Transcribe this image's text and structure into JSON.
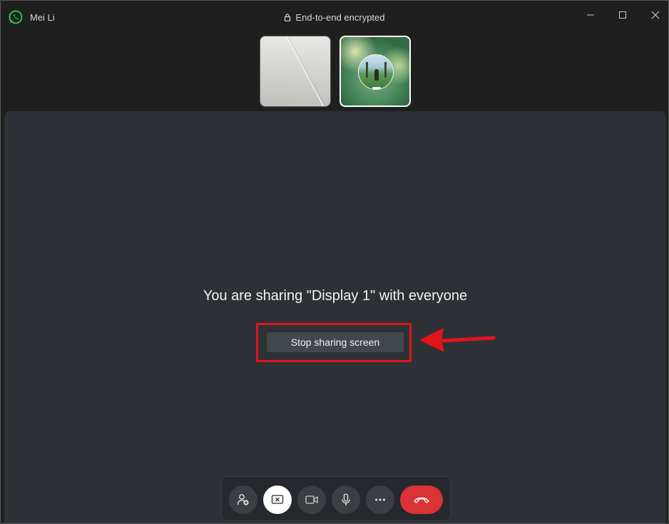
{
  "window": {
    "contact_name": "Mei Li",
    "encryption_label": "End-to-end encrypted"
  },
  "main": {
    "share_message": "You are sharing \"Display 1\" with everyone",
    "stop_button_label": "Stop sharing screen"
  },
  "controls": [
    {
      "name": "add-participant",
      "icon": "person-add-icon"
    },
    {
      "name": "screen-share",
      "icon": "stop-share-icon",
      "active": true
    },
    {
      "name": "video",
      "icon": "video-camera-icon"
    },
    {
      "name": "microphone",
      "icon": "microphone-icon"
    },
    {
      "name": "more-options",
      "icon": "more-icon"
    },
    {
      "name": "end-call",
      "icon": "phone-hangup-icon"
    }
  ],
  "colors": {
    "highlight": "#e3131b",
    "end_call": "#d93336",
    "whatsapp_green": "#25d366"
  }
}
